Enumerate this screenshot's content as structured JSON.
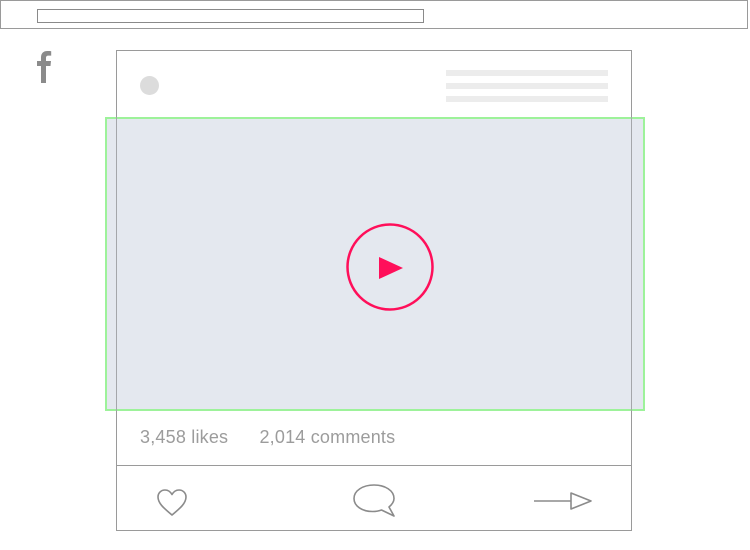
{
  "browser": {
    "address_bar": ""
  },
  "brand": {
    "logo_icon": "facebook-f-icon"
  },
  "post": {
    "avatar_icon": "avatar-placeholder",
    "video": {
      "play_icon": "play-icon",
      "accent_color": "#ff0f5a",
      "placeholder_color": "#e4e8ef",
      "highlight_color": "#9df29a"
    },
    "stats": {
      "likes": "3,458 likes",
      "comments": "2,014 comments"
    },
    "actions": {
      "like_icon": "heart-icon",
      "comment_icon": "speech-bubble-icon",
      "share_icon": "arrow-right-icon"
    }
  }
}
